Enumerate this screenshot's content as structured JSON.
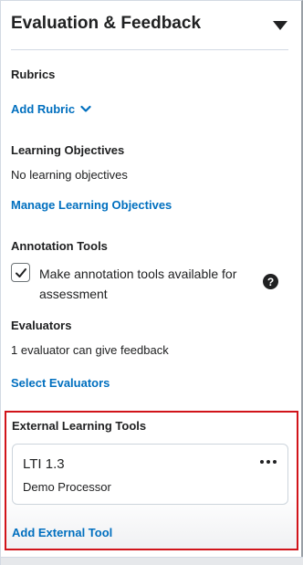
{
  "panel": {
    "title": "Evaluation & Feedback",
    "collapse_icon": "caret-down-icon"
  },
  "rubrics": {
    "title": "Rubrics",
    "add_link": "Add Rubric",
    "add_icon": "chevron-down-icon"
  },
  "objectives": {
    "title": "Learning Objectives",
    "status": "No learning objectives",
    "manage_link": "Manage Learning Objectives"
  },
  "annotation": {
    "title": "Annotation Tools",
    "checkbox_label": "Make annotation tools available for assessment",
    "checked": true,
    "help_icon": "help-circle-icon"
  },
  "evaluators": {
    "title": "Evaluators",
    "status": "1 evaluator can give feedback",
    "select_link": "Select Evaluators"
  },
  "external_tools": {
    "title": "External Learning Tools",
    "highlight_color": "#d1141a",
    "tools": [
      {
        "name": "LTI 1.3",
        "subtitle": "Demo Processor",
        "menu_icon": "more-horizontal-icon"
      }
    ],
    "add_link": "Add External Tool"
  },
  "colors": {
    "link": "#006fbf",
    "text": "#202122",
    "divider": "#d3d9e3"
  }
}
